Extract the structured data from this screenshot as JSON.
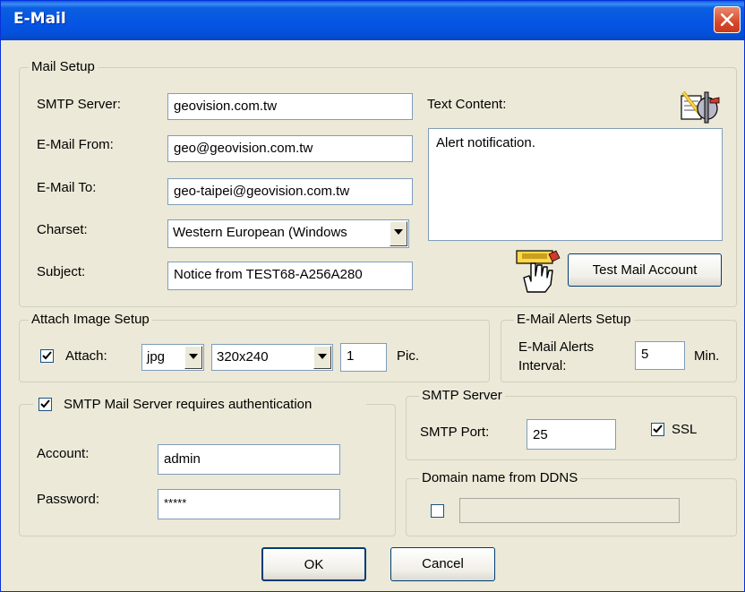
{
  "window": {
    "title": "E-Mail"
  },
  "mail_setup": {
    "legend": "Mail Setup",
    "smtp_server_label": "SMTP Server:",
    "smtp_server_value": "geovision.com.tw",
    "email_from_label": "E-Mail From:",
    "email_from_value": "geo@geovision.com.tw",
    "email_to_label": "E-Mail To:",
    "email_to_value": "geo-taipei@geovision.com.tw",
    "charset_label": "Charset:",
    "charset_value": "Western European (Windows",
    "subject_label": "Subject:",
    "subject_value": "Notice from TEST68-A256A280",
    "text_content_label": "Text Content:",
    "text_content_value": "Alert notification.",
    "test_button_label": "Test Mail Account"
  },
  "attach_image": {
    "legend": "Attach Image Setup",
    "attach_checked": true,
    "attach_label": "Attach:",
    "format_value": "jpg",
    "size_value": "320x240",
    "pic_count_value": "1",
    "pic_label": "Pic."
  },
  "alerts": {
    "legend": "E-Mail Alerts Setup",
    "interval_label_line1": "E-Mail Alerts",
    "interval_label_line2": "Interval:",
    "interval_value": "5",
    "min_label": "Min."
  },
  "auth": {
    "requires_auth_checked": true,
    "requires_auth_label": "SMTP Mail Server requires authentication",
    "account_label": "Account:",
    "account_value": "admin",
    "password_label": "Password:",
    "password_value": "*****"
  },
  "smtp_server": {
    "legend": "SMTP Server",
    "port_label": "SMTP Port:",
    "port_value": "25",
    "ssl_checked": true,
    "ssl_label": "SSL"
  },
  "ddns": {
    "legend": "Domain name from DDNS",
    "checked": false,
    "value": ""
  },
  "buttons": {
    "ok": "OK",
    "cancel": "Cancel"
  },
  "colors": {
    "titlebar": "#0554e3",
    "dialog_bg": "#ece9d8",
    "button_border": "#003c74",
    "close_button": "#d7492b"
  }
}
